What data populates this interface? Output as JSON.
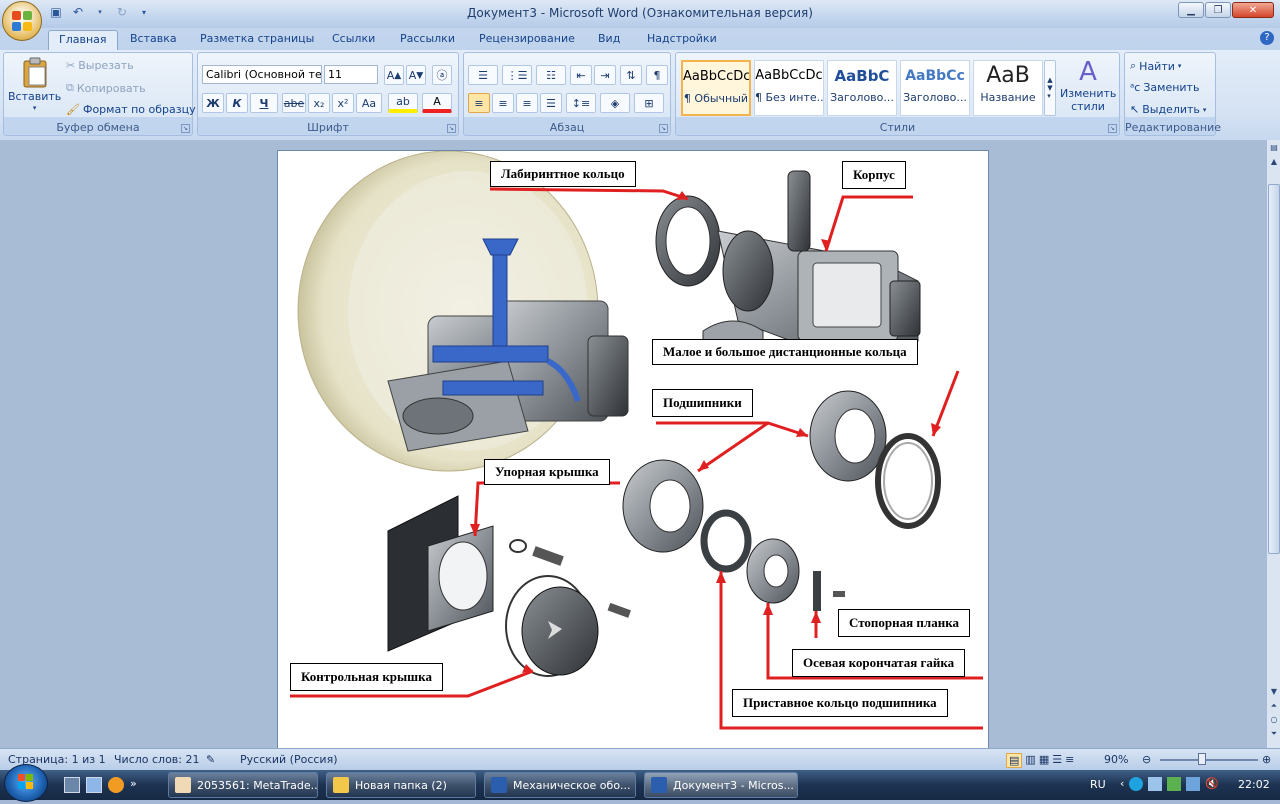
{
  "window": {
    "title": "Документ3 - Microsoft Word (Ознакомительная версия)"
  },
  "tabs": [
    "Главная",
    "Вставка",
    "Разметка страницы",
    "Ссылки",
    "Рассылки",
    "Рецензирование",
    "Вид",
    "Надстройки"
  ],
  "clipboard": {
    "paste": "Вставить",
    "cut": "Вырезать",
    "copy": "Копировать",
    "format_painter": "Формат по образцу",
    "group": "Буфер обмена"
  },
  "font": {
    "name": "Calibri (Основной те",
    "size": "11",
    "group": "Шрифт",
    "bold": "Ж",
    "italic": "К",
    "underline": "Ч",
    "strike": "abe",
    "sub": "x₂",
    "sup": "x²",
    "case": "Aa"
  },
  "paragraph": {
    "group": "Абзац"
  },
  "styles": {
    "group": "Стили",
    "change": "Изменить стили",
    "items": [
      {
        "preview": "AaBbCcDc",
        "name": "¶ Обычный"
      },
      {
        "preview": "AaBbCcDc",
        "name": "¶ Без инте..."
      },
      {
        "preview": "AaBbC",
        "name": "Заголово..."
      },
      {
        "preview": "AaBbCc",
        "name": "Заголово..."
      },
      {
        "preview": "AaB",
        "name": "Название"
      }
    ]
  },
  "editing": {
    "group": "Редактирование",
    "find": "Найти",
    "replace": "Заменить",
    "select": "Выделить"
  },
  "doc": {
    "labels": {
      "labyrinth": "Лабиринтное кольцо",
      "housing": "Корпус",
      "spacers": "Малое и большое  дистанционные  кольца",
      "bearings": "Подшипники",
      "thrust_cover": "Упорная крышка",
      "locking_plate": "Стопорная планка",
      "axial_nut": "Осевая корончатая  гайка",
      "control_cover": "Контрольная крышка",
      "bearing_ring": "Приставное кольцо подшипника"
    }
  },
  "status": {
    "page": "Страница: 1 из 1",
    "words": "Число слов: 21",
    "lang": "Русский (Россия)",
    "zoom": "90%"
  },
  "taskbar": {
    "tasks": [
      "2053561: MetaTrade...",
      "Новая папка (2)",
      "Механическое обо...",
      "Документ3 - Micros..."
    ],
    "lang": "RU",
    "time": "22:02"
  },
  "colors": {
    "arrow": "#e02020",
    "ribbon_bg": "#dce8f6",
    "blueprint": "#2f5fc8"
  }
}
